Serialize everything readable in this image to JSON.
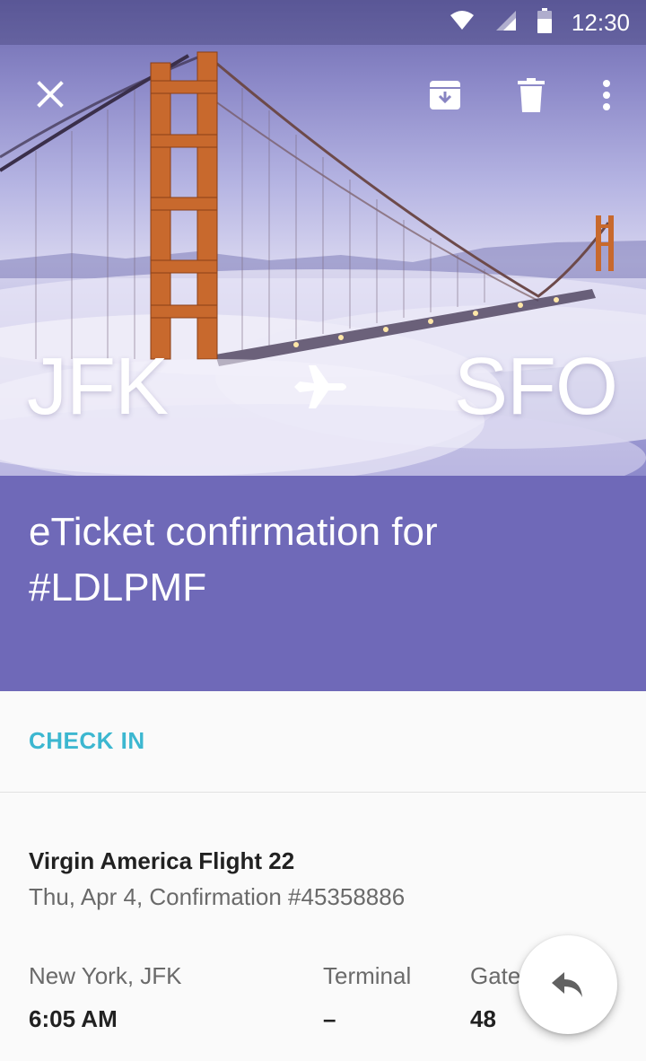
{
  "status_bar": {
    "time": "12:30",
    "icons": [
      "wifi-icon",
      "signal-icon",
      "battery-icon"
    ]
  },
  "toolbar": {
    "close_icon": "close-icon",
    "archive_icon": "archive-icon",
    "delete_icon": "delete-icon",
    "more_icon": "more-vert-icon"
  },
  "hero": {
    "origin": "JFK",
    "destination": "SFO",
    "route_icon": "airplane-icon"
  },
  "email": {
    "subject": "eTicket confirmation for #LDLPMF"
  },
  "actions": {
    "check_in_label": "CHECK IN"
  },
  "flight": {
    "name": "Virgin America Flight 22",
    "details": "Thu, Apr 4, Confirmation #45358886",
    "departure": {
      "label": "New York, JFK",
      "value": "6:05 AM"
    },
    "terminal": {
      "label": "Terminal",
      "value": "–"
    },
    "gate": {
      "label": "Gate",
      "value": "48"
    }
  },
  "fab": {
    "icon": "reply-icon"
  },
  "colors": {
    "accent_purple": "#6f69b8",
    "link_cyan": "#3cb7d0",
    "bridge_orange": "#c8692d"
  }
}
